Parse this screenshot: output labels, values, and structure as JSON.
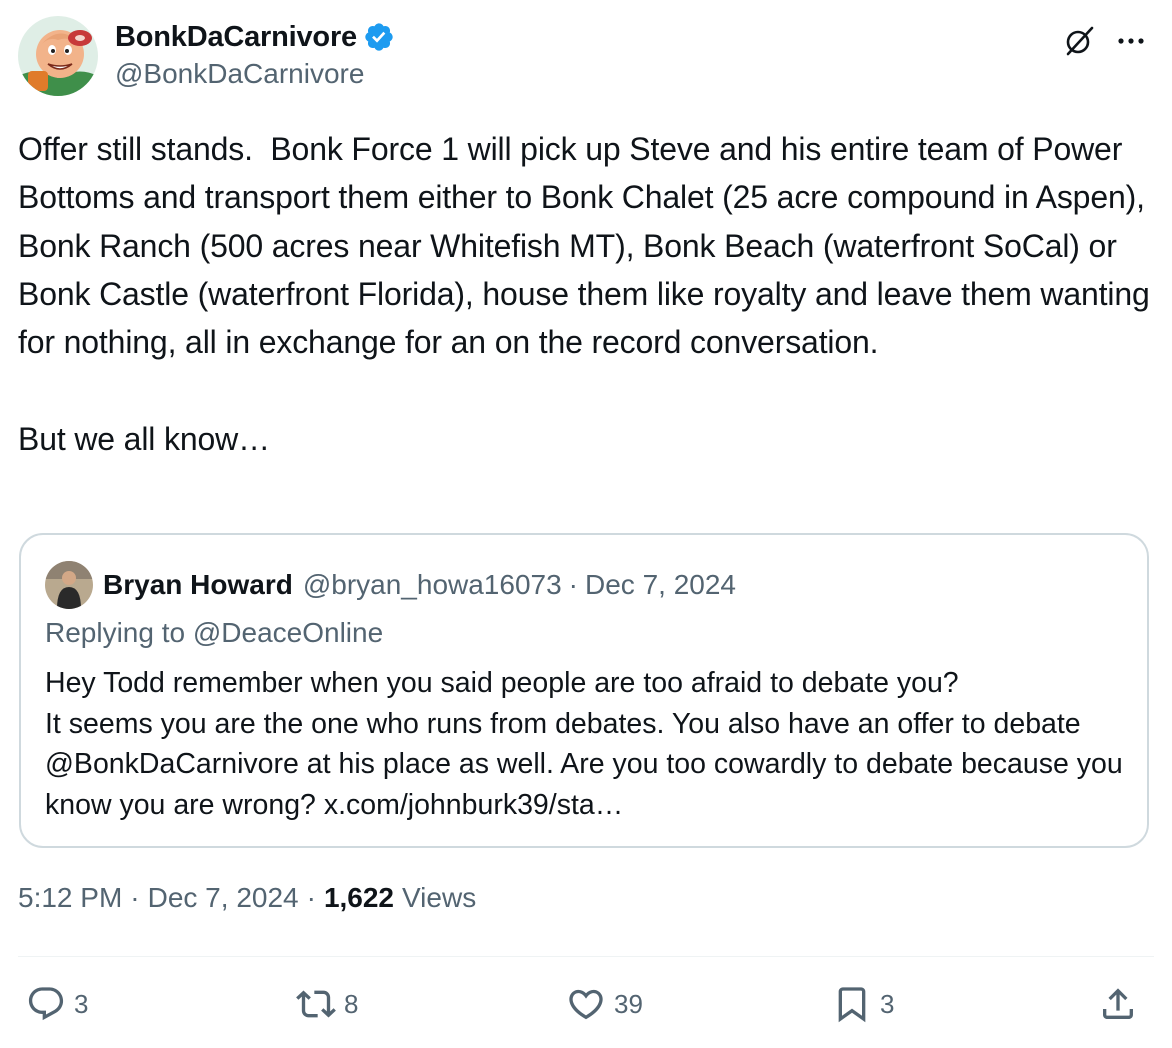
{
  "author": {
    "display_name": "BonkDaCarnivore",
    "handle": "@BonkDaCarnivore",
    "verified": true
  },
  "tweet": {
    "text": "Offer still stands.  Bonk Force 1 will pick up Steve and his entire team of Power Bottoms and transport them either to Bonk Chalet (25 acre compound in Aspen), Bonk Ranch (500 acres near Whitefish MT), Bonk Beach (waterfront SoCal) or Bonk Castle (waterfront Florida), house them like royalty and leave them wanting for nothing, all in exchange for an on the record conversation.\n\nBut we all know…"
  },
  "quote": {
    "display_name": "Bryan Howard",
    "handle": "@bryan_howa16073",
    "date": "Dec 7, 2024",
    "replying_prefix": "Replying to",
    "replying_to": "@DeaceOnline",
    "text": "Hey Todd remember when you said people are too afraid to debate you?\nIt seems you are the one who runs from debates. You also have an offer to debate @BonkDaCarnivore at his place as well. Are you too cowardly to debate because you know you are wrong? x.com/johnburk39/sta…"
  },
  "meta": {
    "time": "5:12 PM",
    "date": "Dec 7, 2024",
    "views_count": "1,622",
    "views_label": "Views"
  },
  "actions": {
    "replies": "3",
    "reposts": "8",
    "likes": "39",
    "bookmarks": "3"
  },
  "colors": {
    "verified_blue": "#1d9bf0",
    "secondary_text": "#536471",
    "primary_text": "#0f1419",
    "border": "#cfd9de"
  },
  "icons": [
    "verified-badge-icon",
    "grok-icon",
    "more-icon",
    "reply-icon",
    "repost-icon",
    "like-icon",
    "bookmark-icon",
    "share-icon"
  ]
}
